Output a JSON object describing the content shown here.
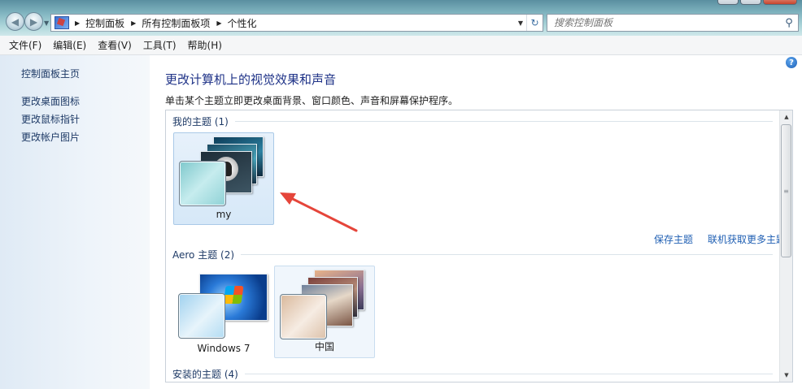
{
  "address_bar": {
    "crumbs": [
      "控制面板",
      "所有控制面板项",
      "个性化"
    ],
    "search_placeholder": "搜索控制面板"
  },
  "menu": [
    "文件(F)",
    "编辑(E)",
    "查看(V)",
    "工具(T)",
    "帮助(H)"
  ],
  "sidebar": {
    "home": "控制面板主页",
    "links": [
      "更改桌面图标",
      "更改鼠标指针",
      "更改帐户图片"
    ]
  },
  "main": {
    "title": "更改计算机上的视觉效果和声音",
    "subtitle": "单击某个主题立即更改桌面背景、窗口颜色、声音和屏幕保护程序。",
    "sections": {
      "my": {
        "header": "我的主题 (1)",
        "themes": [
          "my"
        ]
      },
      "aero": {
        "header": "Aero 主题 (2)",
        "themes": [
          "Windows 7",
          "中国"
        ]
      },
      "installed": {
        "header": "安装的主题 (4)"
      }
    },
    "save_theme": "保存主题",
    "get_more": "联机获取更多主题"
  },
  "colors": {
    "heading": "#1e3287",
    "link": "#1f5fb3",
    "annotation_arrow": "#e5453a"
  }
}
